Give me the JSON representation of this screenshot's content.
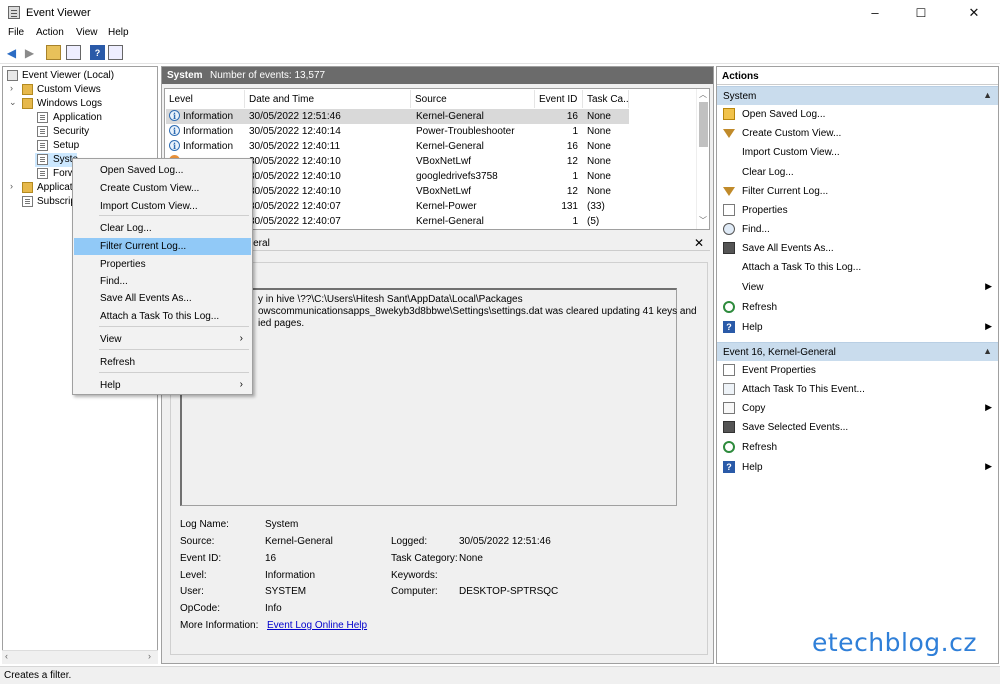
{
  "window": {
    "title": "Event Viewer",
    "minimize": "–",
    "maximize": "☐",
    "close": "✕"
  },
  "menu": [
    "File",
    "Action",
    "View",
    "Help"
  ],
  "tree": {
    "root": "Event Viewer (Local)",
    "custom_views": "Custom Views",
    "windows_logs": "Windows Logs",
    "application": "Application",
    "security": "Security",
    "setup": "Setup",
    "system": "Syste",
    "forwarded": "Forw",
    "apps_services": "Applicati",
    "subscriptions": "Subscript"
  },
  "center": {
    "header_title": "System",
    "header_count": "Number of events: 13,577",
    "columns": [
      "Level",
      "Date and Time",
      "Source",
      "Event ID",
      "Task Ca..."
    ],
    "rows": [
      {
        "level": "Information",
        "date": "30/05/2022 12:51:46",
        "source": "Kernel-General",
        "id": "16",
        "task": "None",
        "icon": "info"
      },
      {
        "level": "Information",
        "date": "30/05/2022 12:40:14",
        "source": "Power-Troubleshooter",
        "id": "1",
        "task": "None",
        "icon": "info"
      },
      {
        "level": "Information",
        "date": "30/05/2022 12:40:11",
        "source": "Kernel-General",
        "id": "16",
        "task": "None",
        "icon": "info"
      },
      {
        "level": "",
        "date": "30/05/2022 12:40:10",
        "source": "VBoxNetLwf",
        "id": "12",
        "task": "None",
        "icon": "warning"
      },
      {
        "level": "",
        "date": "30/05/2022 12:40:10",
        "source": "googledrivefs3758",
        "id": "1",
        "task": "None",
        "icon": ""
      },
      {
        "level": "",
        "date": "30/05/2022 12:40:10",
        "source": "VBoxNetLwf",
        "id": "12",
        "task": "None",
        "icon": ""
      },
      {
        "level": "",
        "date": "30/05/2022 12:40:07",
        "source": "Kernel-Power",
        "id": "131",
        "task": "(33)",
        "icon": ""
      },
      {
        "level": "",
        "date": "30/05/2022 12:40:07",
        "source": "Kernel-General",
        "id": "1",
        "task": "(5)",
        "icon": ""
      }
    ],
    "detail_header": "eneral",
    "description_lines": [
      "y in hive \\??\\C:\\Users\\Hitesh Sant\\AppData\\Local\\Packages",
      "owscommunicationsapps_8wekyb3d8bbwe\\Settings\\settings.dat was cleared updating 41 keys and",
      "ied pages."
    ],
    "details": {
      "log_name_label": "Log Name:",
      "log_name": "System",
      "source_label": "Source:",
      "source": "Kernel-General",
      "logged_label": "Logged:",
      "logged": "30/05/2022 12:51:46",
      "event_id_label": "Event ID:",
      "event_id": "16",
      "task_cat_label": "Task Category:",
      "task_cat": "None",
      "level_label": "Level:",
      "level": "Information",
      "keywords_label": "Keywords:",
      "user_label": "User:",
      "user": "SYSTEM",
      "computer_label": "Computer:",
      "computer": "DESKTOP-SPTRSQC",
      "opcode_label": "OpCode:",
      "opcode": "Info",
      "more_info_label": "More Information:",
      "more_info_link": "Event Log Online Help"
    }
  },
  "actions": {
    "title": "Actions",
    "section1": "System",
    "items1": [
      "Open Saved Log...",
      "Create Custom View...",
      "Import Custom View...",
      "Clear Log...",
      "Filter Current Log...",
      "Properties",
      "Find...",
      "Save All Events As...",
      "Attach a Task To this Log...",
      "View",
      "Refresh",
      "Help"
    ],
    "section2": "Event 16, Kernel-General",
    "items2": [
      "Event Properties",
      "Attach Task To This Event...",
      "Copy",
      "Save Selected Events...",
      "Refresh",
      "Help"
    ]
  },
  "context_menu": [
    "Open Saved Log...",
    "Create Custom View...",
    "Import Custom View...",
    "Clear Log...",
    "Filter Current Log...",
    "Properties",
    "Find...",
    "Save All Events As...",
    "Attach a Task To this Log...",
    "View",
    "Refresh",
    "Help"
  ],
  "status": "Creates a filter.",
  "watermark": "etechblog.cz"
}
